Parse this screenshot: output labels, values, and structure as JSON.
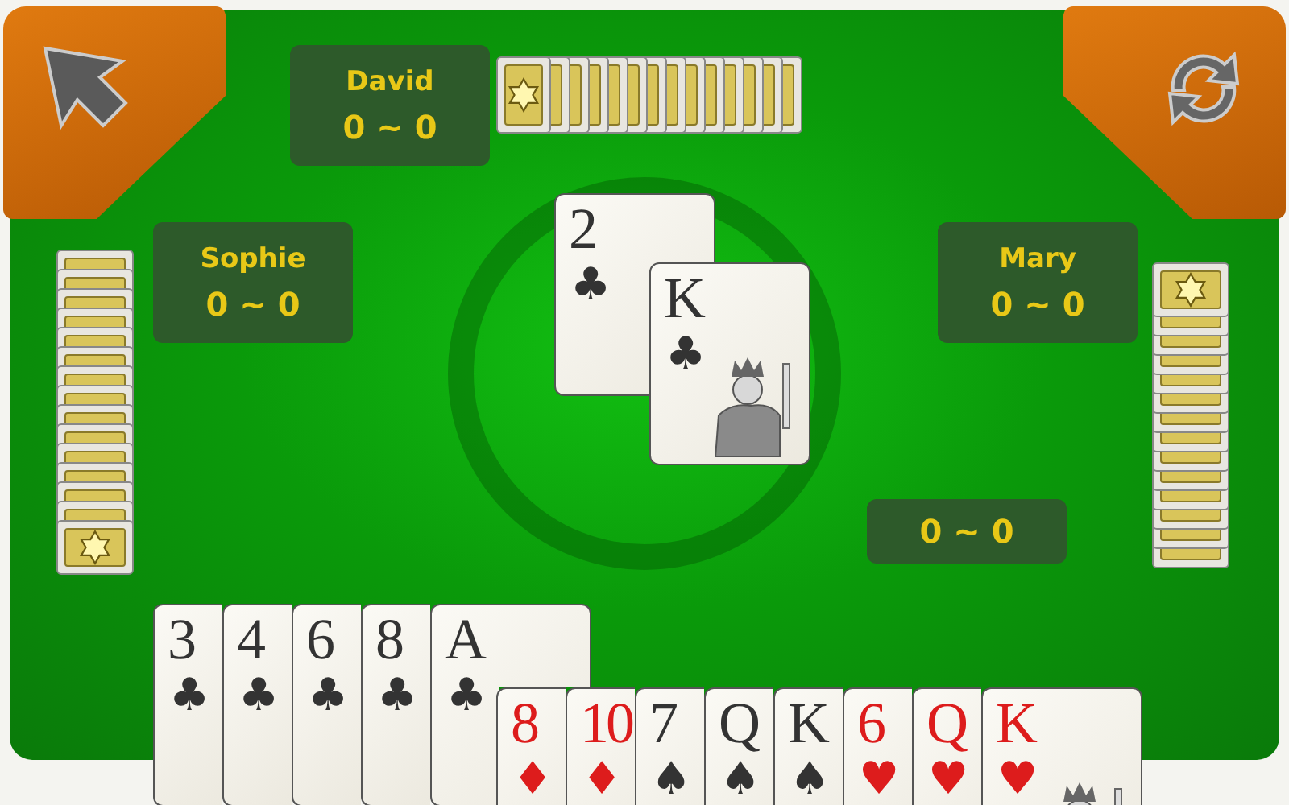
{
  "players": [
    {
      "name": "David",
      "score": "0 ~ 0"
    },
    {
      "name": "Sophie",
      "score": "0 ~ 0"
    },
    {
      "name": "Mary",
      "score": "0 ~ 0"
    }
  ],
  "my_score": "0 ~ 0",
  "trick": [
    {
      "rank": "2",
      "suit": "♣",
      "color": "#333333",
      "figure": false
    },
    {
      "rank": "K",
      "suit": "♣",
      "color": "#333333",
      "figure": true
    }
  ],
  "hand_rows": [
    [
      {
        "rank": "3",
        "suit": "♣",
        "color": "#333333",
        "figure": false
      },
      {
        "rank": "4",
        "suit": "♣",
        "color": "#333333",
        "figure": false
      },
      {
        "rank": "6",
        "suit": "♣",
        "color": "#333333",
        "figure": false
      },
      {
        "rank": "8",
        "suit": "♣",
        "color": "#333333",
        "figure": false
      },
      {
        "rank": "A",
        "suit": "♣",
        "color": "#333333",
        "figure": false
      }
    ],
    [
      {
        "rank": "8",
        "suit": "♦",
        "color": "#dd1c1c",
        "figure": false
      },
      {
        "rank": "10",
        "suit": "♦",
        "color": "#dd1c1c",
        "figure": false
      },
      {
        "rank": "7",
        "suit": "♠",
        "color": "#333333",
        "figure": false
      },
      {
        "rank": "Q",
        "suit": "♠",
        "color": "#333333",
        "figure": false
      },
      {
        "rank": "K",
        "suit": "♠",
        "color": "#333333",
        "figure": false
      },
      {
        "rank": "6",
        "suit": "♥",
        "color": "#dd1c1c",
        "figure": false
      },
      {
        "rank": "Q",
        "suit": "♥",
        "color": "#dd1c1c",
        "figure": false
      },
      {
        "rank": "K",
        "suit": "♥",
        "color": "#dd1c1c",
        "figure": true
      }
    ]
  ]
}
